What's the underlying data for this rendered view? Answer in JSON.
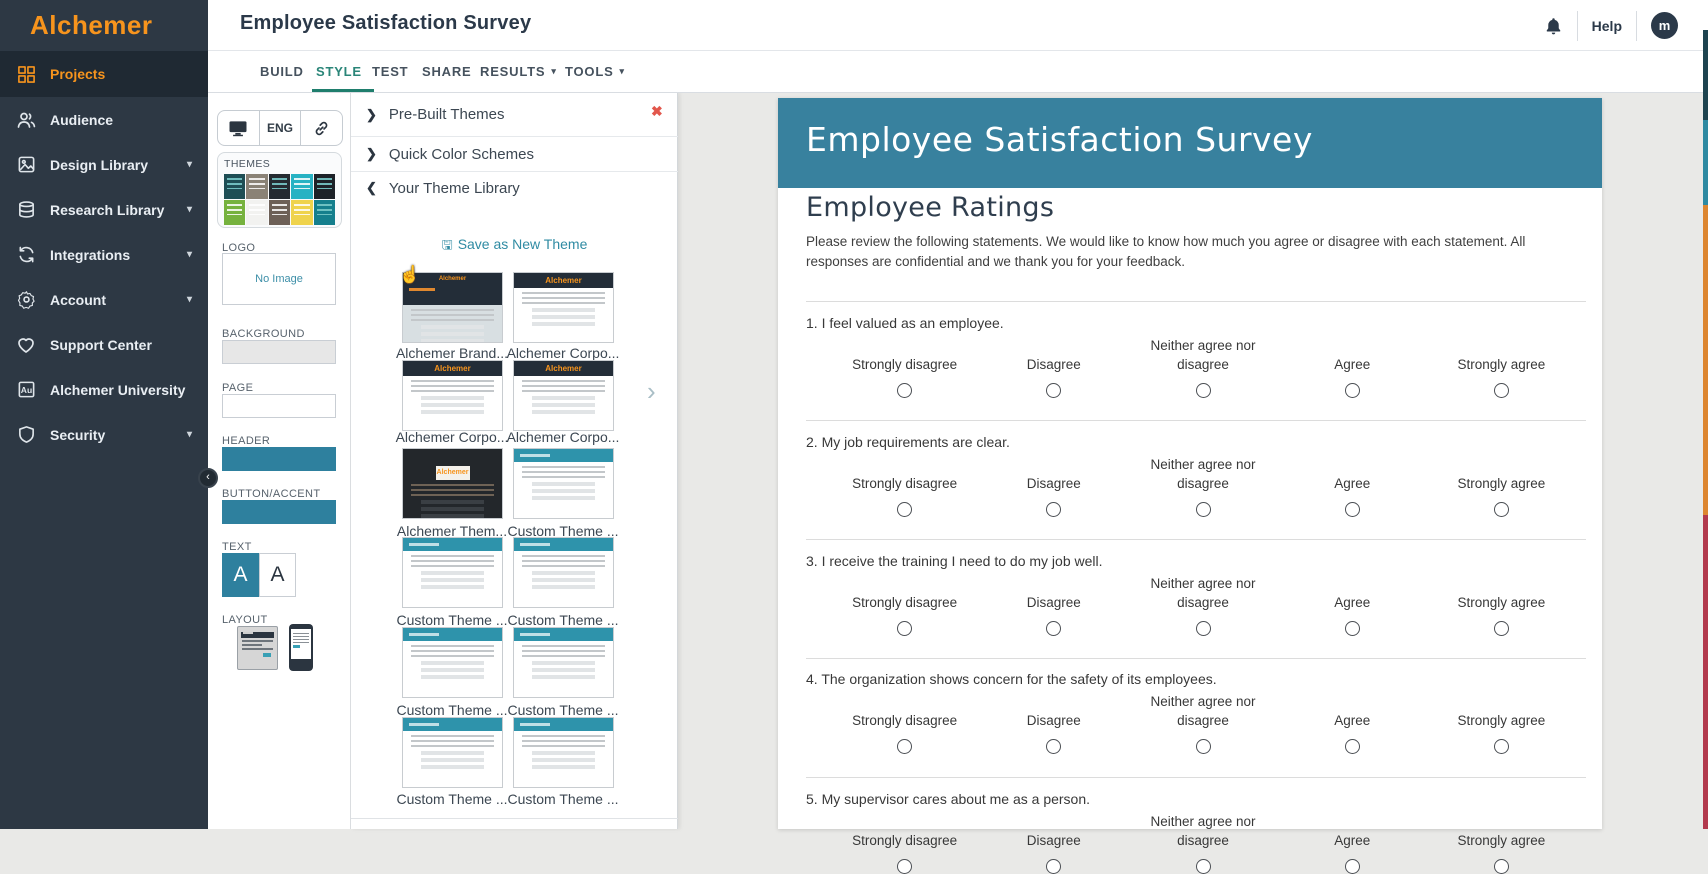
{
  "brand": {
    "name": "Alchemer"
  },
  "header": {
    "title": "Employee Satisfaction Survey",
    "help_label": "Help",
    "avatar_initial": "m"
  },
  "tabs": [
    {
      "label": "BUILD"
    },
    {
      "label": "STYLE"
    },
    {
      "label": "TEST"
    },
    {
      "label": "SHARE"
    },
    {
      "label": "RESULTS",
      "caret": "▾"
    },
    {
      "label": "TOOLS",
      "caret": "▾"
    }
  ],
  "sidebar": {
    "items": [
      {
        "label": "Projects"
      },
      {
        "label": "Audience"
      },
      {
        "label": "Design Library",
        "caret": "▾"
      },
      {
        "label": "Research Library",
        "caret": "▾"
      },
      {
        "label": "Integrations",
        "caret": "▾"
      },
      {
        "label": "Account",
        "caret": "▾"
      },
      {
        "label": "Support Center"
      },
      {
        "label": "Alchemer University"
      },
      {
        "label": "Security",
        "caret": "▾"
      }
    ]
  },
  "style_panel": {
    "device_lang": "ENG",
    "themes_label": "THEMES",
    "logo_label": "LOGO",
    "logo_placeholder": "No Image",
    "background_label": "BACKGROUND",
    "page_label": "PAGE",
    "header_label": "HEADER",
    "button_accent_label": "BUTTON/ACCENT",
    "text_label": "TEXT",
    "text_sample": "A",
    "layout_label": "LAYOUT",
    "header_color": "#2e809e",
    "button_accent_color": "#2e809e"
  },
  "theme_library": {
    "close": "✖",
    "sections": [
      {
        "title": "Pre-Built Themes",
        "chevron": "›"
      },
      {
        "title": "Quick Color Schemes",
        "chevron": "›"
      },
      {
        "title": "Your Theme Library",
        "chevron": "⌄"
      }
    ],
    "save_link": "Save as New Theme",
    "save_icon": "🖫",
    "themes": [
      {
        "name": "Alchemer Brand..."
      },
      {
        "name": "Alchemer Corpo..."
      },
      {
        "name": "Alchemer Corpo..."
      },
      {
        "name": "Alchemer Corpo..."
      },
      {
        "name": "Alchemer Them..."
      },
      {
        "name": "Custom Theme ..."
      },
      {
        "name": "Custom Theme ..."
      },
      {
        "name": "Custom Theme ..."
      },
      {
        "name": "Custom Theme ..."
      },
      {
        "name": "Custom Theme ..."
      },
      {
        "name": "Custom Theme ..."
      },
      {
        "name": "Custom Theme ..."
      }
    ],
    "mini_logo": "Alchemer"
  },
  "preview": {
    "survey_title": "Employee Satisfaction Survey",
    "page_title": "Employee Ratings",
    "description": "Please review the following statements. We would like to know how much you agree or disagree with each statement. All responses are confidential and we thank you for your feedback.",
    "header_color": "#38819e",
    "questions": [
      {
        "text": "1. I feel valued as an employee."
      },
      {
        "text": "2. My job requirements are clear."
      },
      {
        "text": "3. I receive the training I need to do my job well."
      },
      {
        "text": "4. The organization shows concern for the safety of its employees."
      },
      {
        "text": "5. My supervisor cares about me as a person."
      }
    ],
    "scale": [
      {
        "label": "Strongly disagree"
      },
      {
        "label": "Disagree"
      },
      {
        "label": "Neither agree nor\ndisagree"
      },
      {
        "label": "Agree"
      },
      {
        "label": "Strongly agree"
      }
    ]
  }
}
